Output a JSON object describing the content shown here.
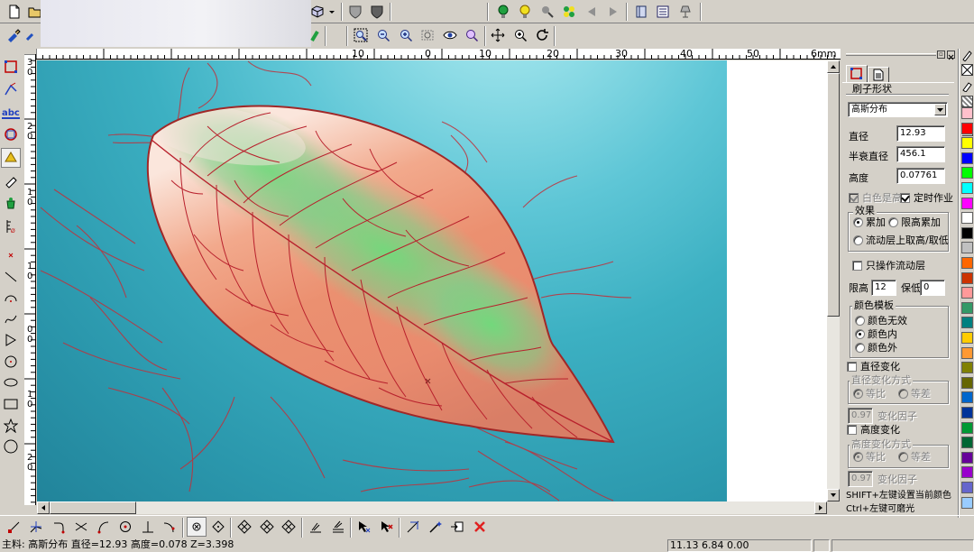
{
  "ruler": {
    "labels": [
      "10",
      "0",
      "10",
      "20",
      "30",
      "40",
      "50",
      "6mm"
    ],
    "vertical_labels": [
      "3",
      "2",
      "1",
      "1",
      "0",
      "1",
      "2",
      "3"
    ],
    "vertical_sublabels": [
      "0",
      "0",
      "0",
      "0",
      "0",
      "0",
      "0",
      "0"
    ]
  },
  "panel": {
    "shape_header": "刷子形状",
    "shape_select": "高斯分布",
    "diameter_label": "直径",
    "diameter_value": "12.93",
    "half_decay_label": "半衰直径",
    "half_decay_value": "456.1",
    "height_label": "高度",
    "height_value": "0.07761",
    "white_high_label": "白色是高",
    "timed_work_label": "定时作业",
    "effect_title": "效果",
    "effect_add_label": "累加",
    "effect_limit_add_label": "限高累加",
    "effect_flow_label": "流动层上取高/取低",
    "only_flow_label": "只操作流动层",
    "limit_high_label": "限高",
    "limit_high_value": "12",
    "keep_low_label": "保低",
    "keep_low_value": "0",
    "color_template_title": "颜色模板",
    "color_none_label": "颜色无效",
    "color_inside_label": "颜色内",
    "color_outside_label": "颜色外",
    "diameter_change_label": "直径变化",
    "diameter_change_mode_title": "直径变化方式",
    "ratio_label": "等比",
    "diff_label": "等差",
    "factor1_value": "0.97",
    "factor_label": "变化因子",
    "height_change_label": "高度变化",
    "height_change_mode_title": "高度变化方式",
    "ratio2_label": "等比",
    "diff2_label": "等差",
    "factor2_value": "0.97",
    "factor2_label": "变化因子",
    "hint1": "SHIFT+左键设置当前颜色",
    "hint2": "Ctrl+左键可磨光"
  },
  "status": {
    "left_text": "主料: 高斯分布   直径=12.93   高度=0.078  Z=3.398",
    "coords": "11.13  6.84 0.00"
  },
  "palette": [
    "#ffc0cb",
    "#ff0000",
    "#ffff00",
    "#0000ff",
    "#00ff00",
    "#00ffff",
    "#ff00ff",
    "#ffffff",
    "#000000",
    "#c0c0c0",
    "#ff6600",
    "#cc3300",
    "#ff9999",
    "#339966",
    "#008080",
    "#ffcc00",
    "#ff9933",
    "#808000",
    "#666600",
    "#0066cc",
    "#003399",
    "#009933",
    "#006633",
    "#660099",
    "#9900cc",
    "#6666cc",
    "#99ccff"
  ],
  "icons": {
    "toolbar_top": [
      "new-file-icon",
      "open-file-icon",
      "box-3d-icon",
      "shield-light-icon",
      "shield-dark-icon",
      "green-bulb-icon",
      "yellow-bulb-icon",
      "light-settings-icon",
      "light-group-icon",
      "arrow-left-icon",
      "arrow-right-icon",
      "book-icon",
      "list-icon",
      "lamp-icon"
    ],
    "toolbar_second": [
      "brush-tool-icon",
      "paint-tool-icon",
      "green-tool-icon",
      "zoom-window-icon",
      "zoom-out-icon",
      "zoom-in-icon",
      "zoom-rect-icon",
      "view-eye-icon",
      "zoom-fit-icon",
      "pan-icon",
      "zoom-realtime-icon",
      "refresh-icon"
    ],
    "left_tools": [
      "select-rect-icon",
      "select-node-icon",
      "text-abc-icon",
      "shape-edit-icon",
      "relief-icon",
      "eraser-icon",
      "bucket-icon",
      "scale-ruler-icon",
      "point-icon",
      "line-icon",
      "arc-icon",
      "curve-icon",
      "polyline-icon",
      "circle-point-icon",
      "ellipse-icon",
      "rectangle-icon",
      "star-icon",
      "circle-icon"
    ],
    "bottom_tools": [
      "line-node-icon",
      "node-edit-icon",
      "corner-icon",
      "cross-icon",
      "arc-node-icon",
      "circle-node-icon",
      "trim-icon",
      "close-node-icon",
      "diamond1-icon",
      "diamond2-icon",
      "diamond3-icon",
      "align-icon",
      "layer-icon",
      "cursor-x-icon",
      "cursor-red-x-icon",
      "transform-icon",
      "magic-icon",
      "export-icon",
      "delete-icon"
    ]
  }
}
